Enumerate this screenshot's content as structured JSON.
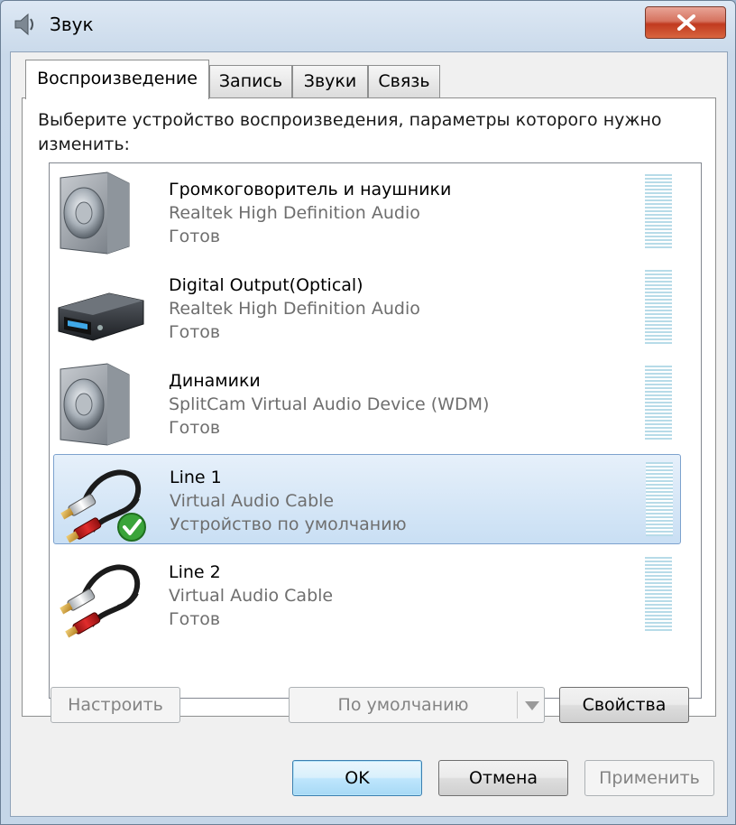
{
  "window": {
    "title": "Звук"
  },
  "tabs": [
    {
      "label": "Воспроизведение",
      "active": true
    },
    {
      "label": "Запись",
      "active": false
    },
    {
      "label": "Звуки",
      "active": false
    },
    {
      "label": "Связь",
      "active": false
    }
  ],
  "instructions": "Выберите устройство воспроизведения, параметры которого нужно изменить:",
  "devices": [
    {
      "name": "Громкоговоритель и наушники",
      "driver": "Realtek High Definition Audio",
      "status": "Готов",
      "icon": "speaker-icon",
      "selected": false
    },
    {
      "name": "Digital Output(Optical)",
      "driver": "Realtek High Definition Audio",
      "status": "Готов",
      "icon": "digital-receiver-icon",
      "selected": false
    },
    {
      "name": "Динамики",
      "driver": "SplitCam Virtual Audio Device (WDM)",
      "status": "Готов",
      "icon": "speaker-icon",
      "selected": false
    },
    {
      "name": "Line 1",
      "driver": "Virtual Audio Cable",
      "status": "Устройство по умолчанию",
      "icon": "rca-cable-icon",
      "selected": true,
      "default_badge": "green-checkmark-icon"
    },
    {
      "name": "Line 2",
      "driver": "Virtual Audio Cable",
      "status": "Готов",
      "icon": "rca-cable-icon",
      "selected": false
    }
  ],
  "buttons": {
    "configure": "Настроить",
    "set_default": "По умолчанию",
    "properties": "Свойства",
    "ok": "OK",
    "cancel": "Отмена",
    "apply": "Применить"
  },
  "colors": {
    "selection_bg": "#cfe3f6",
    "selection_border": "#7da2ce",
    "close_button": "#c7432b",
    "level_meter": "#b7dbe8"
  }
}
